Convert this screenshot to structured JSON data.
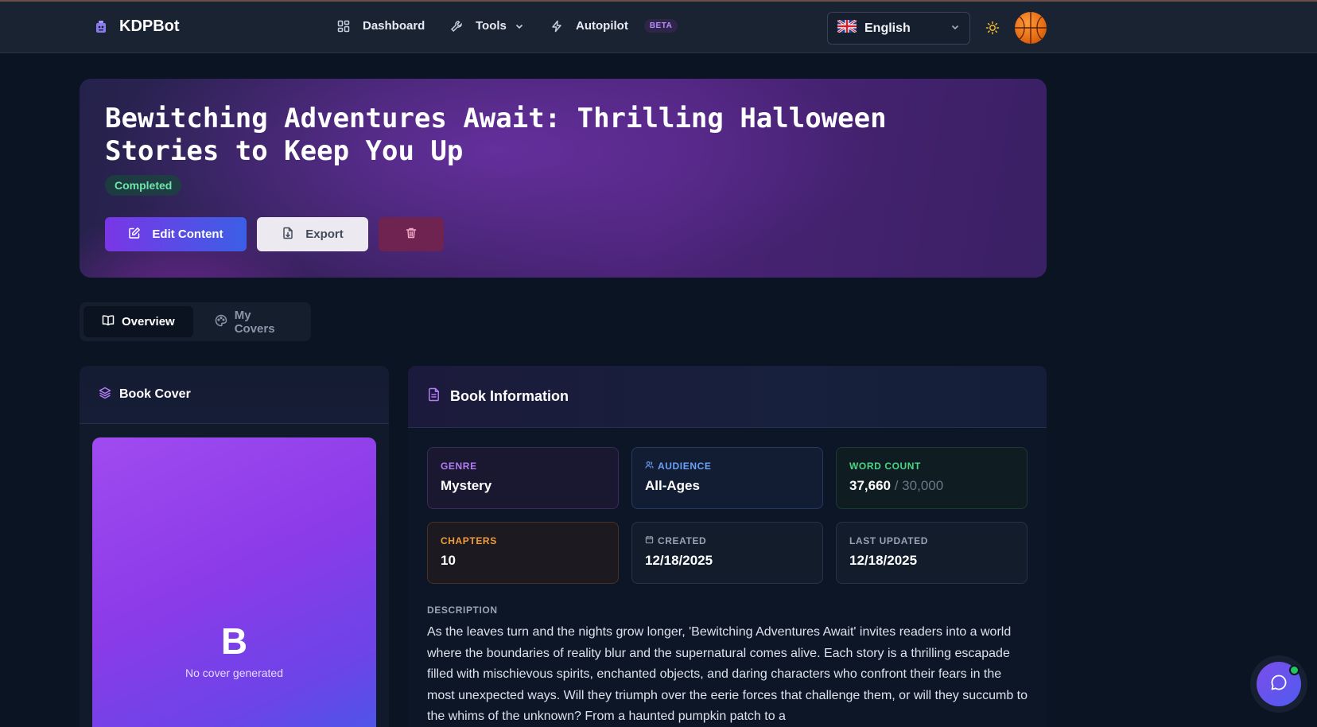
{
  "header": {
    "brand_name": "KDPBot",
    "nav": {
      "dashboard": "Dashboard",
      "tools": "Tools",
      "autopilot": "Autopilot",
      "autopilot_badge": "BETA"
    },
    "language": {
      "selected": "English",
      "flag": "uk-flag"
    }
  },
  "hero": {
    "title": "Bewitching Adventures Await: Thrilling Halloween Stories to Keep You Up",
    "status": "Completed",
    "buttons": {
      "edit": "Edit Content",
      "export": "Export",
      "delete_icon": "trash-icon"
    }
  },
  "tabs": [
    {
      "label": "Overview",
      "icon": "book-open-icon",
      "active": true
    },
    {
      "label": "My Covers",
      "icon": "palette-icon",
      "active": false
    }
  ],
  "cover_card": {
    "title": "Book Cover",
    "placeholder_letter": "B",
    "placeholder_text": "No cover generated"
  },
  "info_card": {
    "title": "Book Information",
    "stats": {
      "genre": {
        "label": "GENRE",
        "value": "Mystery"
      },
      "audience": {
        "label": "AUDIENCE",
        "value": "All-Ages"
      },
      "word_count": {
        "label": "WORD COUNT",
        "value": "37,660",
        "target": "/ 30,000"
      },
      "chapters": {
        "label": "CHAPTERS",
        "value": "10"
      },
      "created": {
        "label": "CREATED",
        "value": "12/18/2025"
      },
      "updated": {
        "label": "LAST UPDATED",
        "value": "12/18/2025"
      }
    },
    "description_label": "DESCRIPTION",
    "description": "As the leaves turn and the nights grow longer, 'Bewitching Adventures Await' invites readers into a world where the boundaries of reality blur and the supernatural comes alive. Each story is a thrilling escapade filled with mischievous spirits, enchanted objects, and daring characters who confront their fears in the most unexpected ways. Will they triumph over the eerie forces that challenge them, or will they succumb to the whims of the unknown? From a haunted pumpkin patch to a"
  },
  "colors": {
    "background": "#0b1423",
    "accent_purple": "#7a36e6",
    "accent_blue": "#3b5fe6",
    "success": "#6ee7a7"
  }
}
